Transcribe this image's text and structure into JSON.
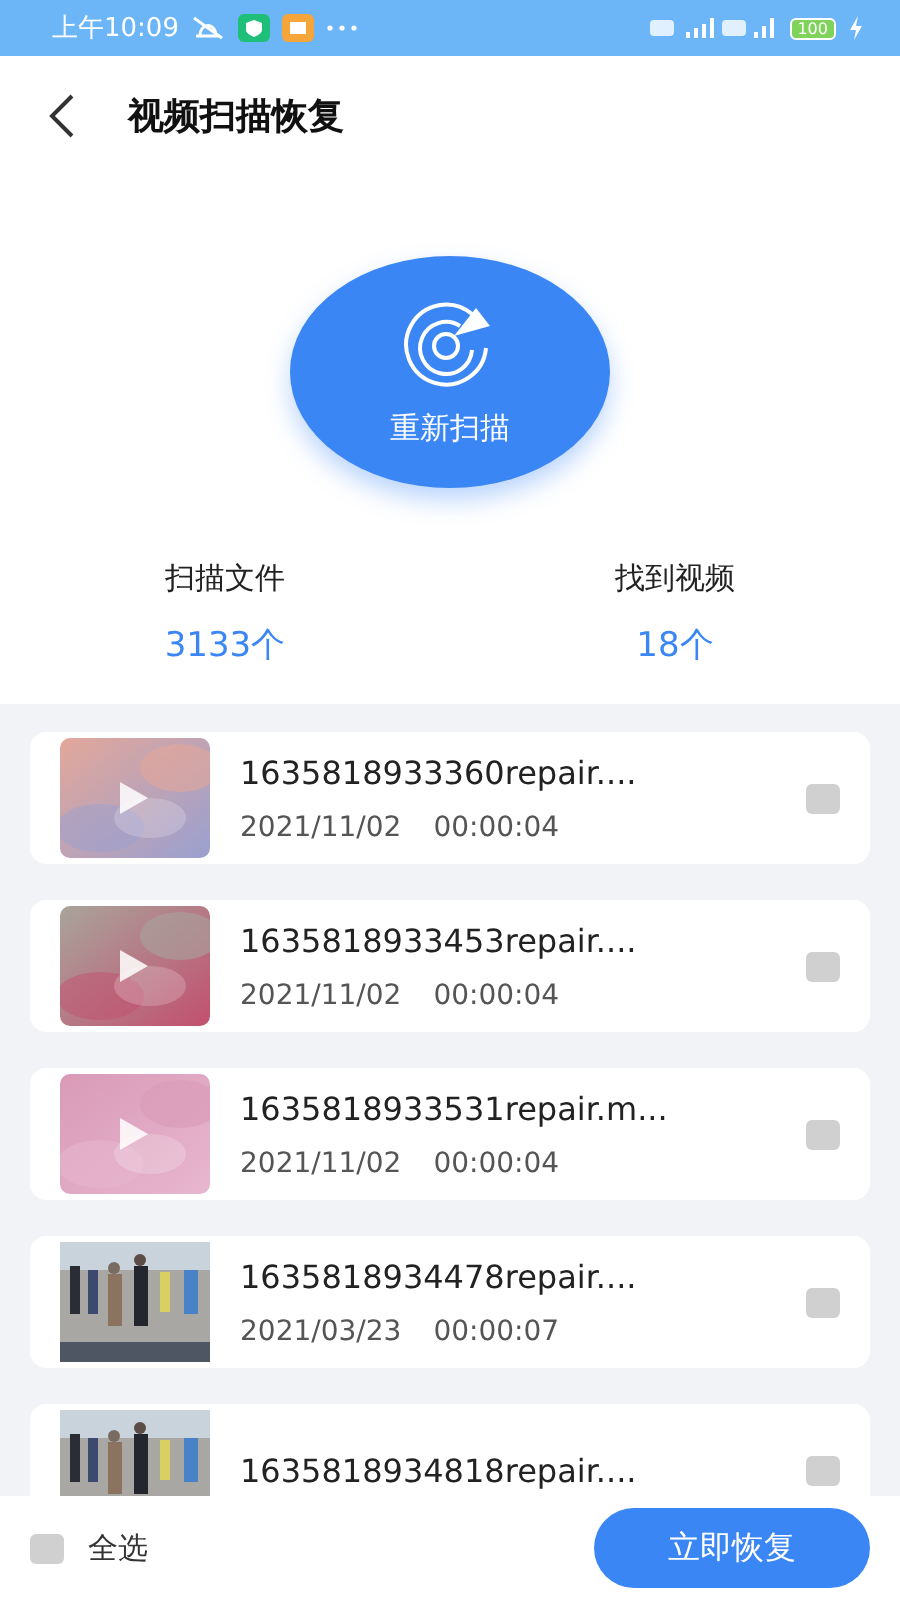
{
  "status_bar": {
    "time": "上午10:09",
    "battery": "100"
  },
  "header": {
    "title": "视频扫描恢复"
  },
  "scan": {
    "button": "重新扫描"
  },
  "stats": [
    {
      "label": "扫描文件",
      "value": "3133个"
    },
    {
      "label": "找到视频",
      "value": "18个"
    }
  ],
  "videos": [
    {
      "name": "1635818933360repair....",
      "date": "2021/11/02",
      "duration": "00:00:04",
      "checked": false
    },
    {
      "name": "1635818933453repair....",
      "date": "2021/11/02",
      "duration": "00:00:04",
      "checked": false
    },
    {
      "name": "1635818933531repair.m...",
      "date": "2021/11/02",
      "duration": "00:00:04",
      "checked": false
    },
    {
      "name": "1635818934478repair....",
      "date": "2021/03/23",
      "duration": "00:00:07",
      "checked": false
    },
    {
      "name": "1635818934818repair....",
      "checked": false
    }
  ],
  "footer": {
    "select_all": {
      "label": "全选",
      "checked": false
    },
    "button": "立即恢复"
  }
}
